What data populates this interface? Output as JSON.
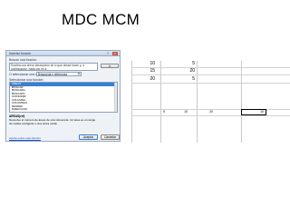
{
  "slide": {
    "title": "MDC MCM"
  },
  "dialog": {
    "title": "Insertar función",
    "help_glyph": "?",
    "close_glyph": "×",
    "search_label": "Buscar una función:",
    "search_text": "Escriba una breve descripción de lo que desea hacer y, a continuación, haga clic en Ir",
    "search_button": "Ir",
    "category_label": "O seleccionar una categoría:",
    "category_value": "Búsqueda y referencia",
    "category_arrow": "▾",
    "list_label": "Seleccionar una función:",
    "functions": [
      {
        "name": "AREAS",
        "selected": true
      },
      {
        "name": "BUSCAR",
        "selected": false
      },
      {
        "name": "BUSCARH",
        "selected": false
      },
      {
        "name": "BUSCARV",
        "selected": false
      },
      {
        "name": "COINCIDIR",
        "selected": false
      },
      {
        "name": "COLUMNA",
        "selected": false
      },
      {
        "name": "COLUMNAS",
        "selected": false
      },
      {
        "name": "DESREF",
        "selected": false
      },
      {
        "name": "DIRECCION",
        "selected": false
      }
    ],
    "signature": "AREAS(ref)",
    "description": "Devuelve el número de áreas de una referencia. Un área es un rango de celdas contiguas o una única celda.",
    "help_link": "Ayuda sobre esta función",
    "ok_button": "Aceptar",
    "cancel_button": "Cancelar"
  },
  "sheet": {
    "row1": {
      "a": "10",
      "b": "5"
    },
    "row2": {
      "a": "15",
      "b": "20"
    },
    "row3": {
      "a": "20",
      "b": "5"
    },
    "formula_row": {
      "c1": "5",
      "c2": "10",
      "c3": "20",
      "c4": "10"
    }
  }
}
